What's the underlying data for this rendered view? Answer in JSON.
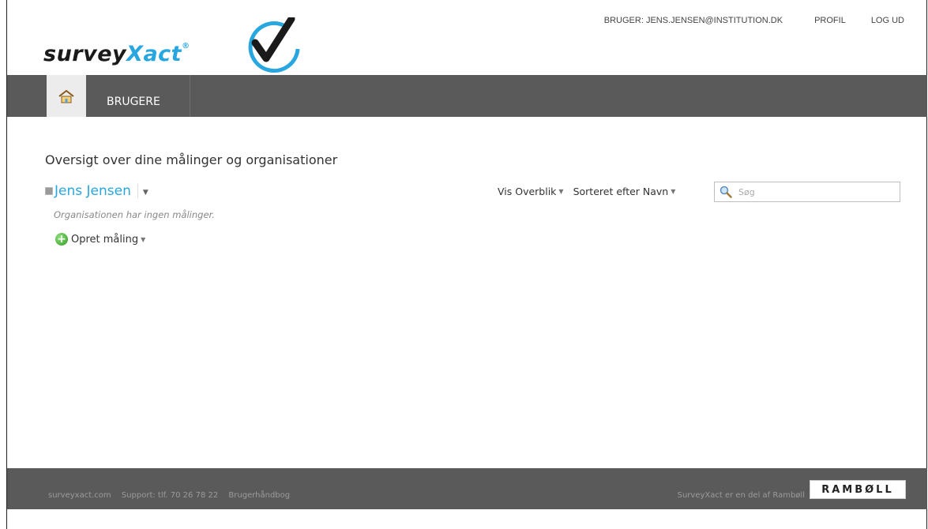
{
  "header": {
    "logo": {
      "survey": "survey",
      "xact": "Xact",
      "reg": "®"
    },
    "user_label": "BRUGER: JENS.JENSEN@INSTITUTION.DK",
    "profile_label": "PROFIL",
    "logout_label": "LOG UD"
  },
  "nav": {
    "home_icon": "home-icon",
    "items": [
      {
        "label": "BRUGERE"
      }
    ]
  },
  "main": {
    "title": "Oversigt over dine målinger og organisationer",
    "org_name": "Jens Jensen",
    "org_note": "Organisationen har ingen målinger.",
    "create_label": "Opret måling",
    "view_label": "Vis Overblik",
    "sort_label": "Sorteret efter Navn",
    "search_placeholder": "Søg"
  },
  "footer": {
    "links": [
      "surveyxact.com",
      "Support: tlf. 70 26 78 22",
      "Brugerhåndbog"
    ],
    "tagline": "SurveyXact er en del af Rambøll",
    "ramboll_logo": "RAMBØLL"
  },
  "colors": {
    "accent": "#28a6df",
    "bar": "#5a5a5a"
  }
}
